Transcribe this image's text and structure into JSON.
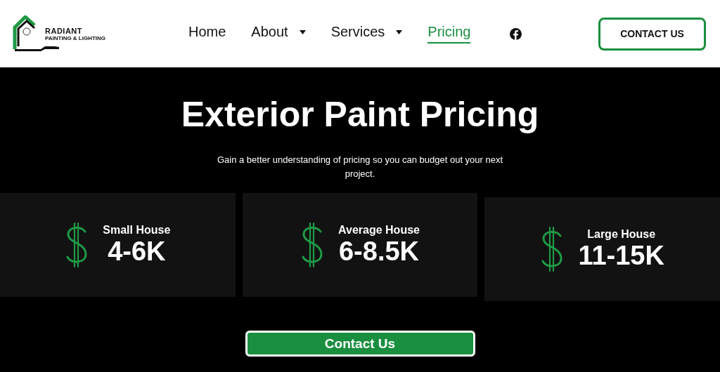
{
  "logo": {
    "name": "RADIANT",
    "tagline": "PAINTING & LIGHTING"
  },
  "nav": [
    {
      "label": "Home",
      "selected": false,
      "dropdown": false
    },
    {
      "label": "About",
      "selected": false,
      "dropdown": true
    },
    {
      "label": "Services",
      "selected": false,
      "dropdown": true
    },
    {
      "label": "Pricing",
      "selected": true,
      "dropdown": false
    }
  ],
  "header_button": "CONTACT US",
  "hero": {
    "title": "Exterior Paint Pricing",
    "subtitle": "Gain a better understanding of pricing so you can budget out your next project."
  },
  "cards": [
    {
      "label": "Small House",
      "price": "4-6K"
    },
    {
      "label": "Average House",
      "price": "6-8.5K"
    },
    {
      "label": "Large House",
      "price": "11-15K"
    }
  ],
  "cta_button": "Contact Us"
}
